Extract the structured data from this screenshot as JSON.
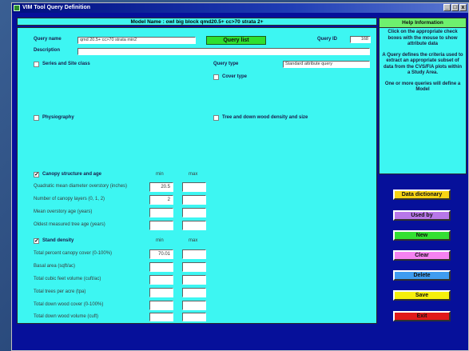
{
  "window": {
    "title": "VIM Tool Query Definition",
    "controls": [
      "_",
      "□",
      "x"
    ]
  },
  "model_bar": "Model Name : owl big block qmd20.5+ cc>70 strata 2+",
  "query": {
    "name_label": "Query name",
    "name_value": "qmd 20.5+ cc>70 strata min2",
    "query_list_button": "Query list",
    "id_label": "Query ID",
    "id_value": "168",
    "description_label": "Description",
    "description_value": "",
    "type_label": "Query type",
    "type_value": "Standard attribute query"
  },
  "classes": {
    "series_site": {
      "label": "Series and Site class",
      "checked": false
    },
    "cover_type": {
      "label": "Cover type",
      "checked": false
    },
    "physiography": {
      "label": "Physiography",
      "checked": false
    },
    "tree_down_wood": {
      "label": "Tree and down wood density and size",
      "checked": false
    }
  },
  "canopy": {
    "label": "Canopy structure and age",
    "checked": true,
    "min_label": "min",
    "max_label": "max",
    "rows": [
      {
        "label": "Quadratic mean diameter overstory (inches)",
        "min": "20.5",
        "max": ""
      },
      {
        "label": "Number of canopy layers (0, 1, 2)",
        "min": "2",
        "max": ""
      },
      {
        "label": "Mean overstory age (years)",
        "min": "",
        "max": ""
      },
      {
        "label": "Oldest measured tree age (years)",
        "min": "",
        "max": ""
      }
    ]
  },
  "density": {
    "label": "Stand density",
    "checked": true,
    "min_label": "min",
    "max_label": "max",
    "rows": [
      {
        "label": "Total percent canopy cover (0-100%)",
        "min": "70.01",
        "max": ""
      },
      {
        "label": "Basal area (sqft/ac)",
        "min": "",
        "max": ""
      },
      {
        "label": "Total cubic feet volume (cuft/ac)",
        "min": "",
        "max": ""
      },
      {
        "label": "Total trees per acre (tpa)",
        "min": "",
        "max": ""
      },
      {
        "label": "Total down wood cover (0-100%)",
        "min": "",
        "max": ""
      },
      {
        "label": "Total down wood volume (cuft)",
        "min": "",
        "max": ""
      }
    ]
  },
  "help": {
    "header": "Help Information",
    "paragraphs": [
      "Click on the appropriate check boxes with the mouse to show attribute data",
      "A Query defines the criteria used to extract an appropriate subset of data from the CVS/FIA plots within a Study Area.",
      "One or more queries will define a Model"
    ]
  },
  "side_buttons": {
    "data_dictionary": "Data dictionary",
    "used_by": "Used by",
    "new": "New",
    "clear": "Clear",
    "delete": "Delete",
    "save": "Save",
    "exit": "Exit"
  },
  "colors": {
    "panel": "#3df6f2",
    "window_bg": "#06109a",
    "data_dictionary": "#f7d414",
    "used_by": "#b777e8",
    "new": "#33e033",
    "clear": "#f582f0",
    "delete": "#3f9cf0",
    "save": "#f5f00d",
    "exit": "#e01a1a"
  }
}
